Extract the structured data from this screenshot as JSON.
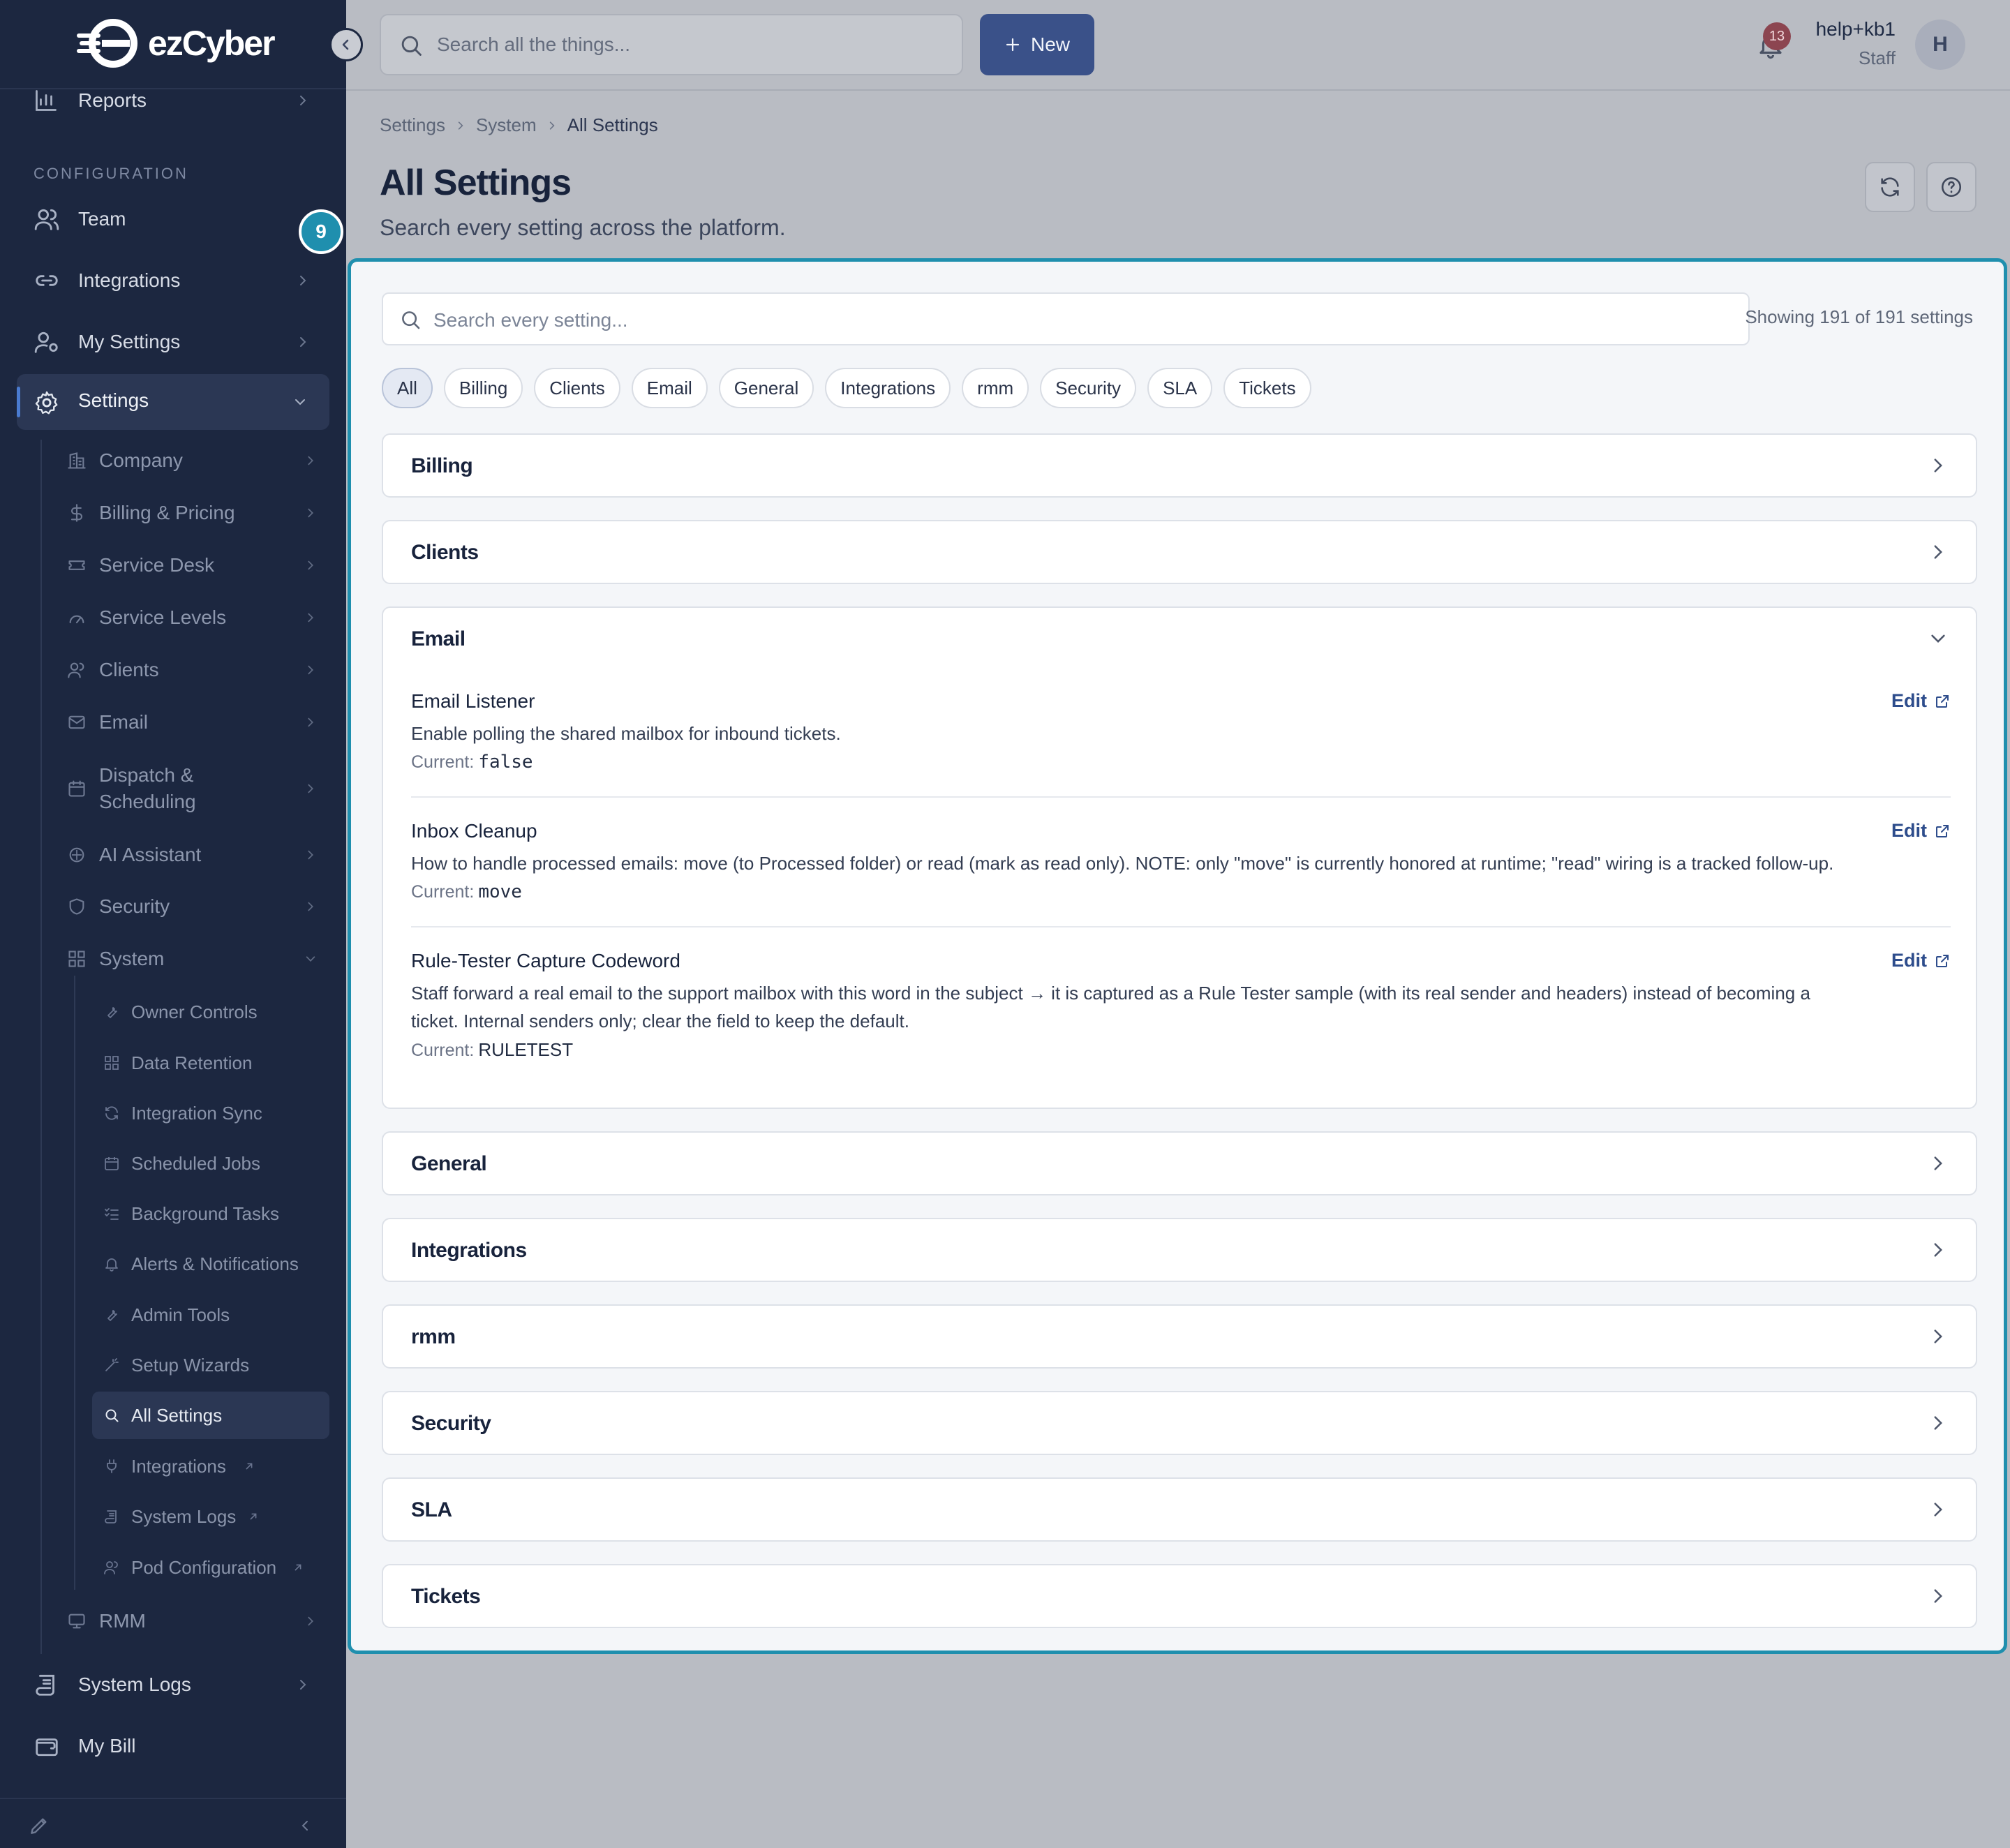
{
  "app": {
    "brand": "ezCyber",
    "accent": "#1f8fae",
    "primary_button": "#3a5189"
  },
  "sidebar": {
    "top_items": [
      {
        "label": "Reports",
        "icon": "bar-chart-icon"
      }
    ],
    "section_title": "CONFIGURATION",
    "config_items": [
      {
        "label": "Team",
        "icon": "users-icon"
      },
      {
        "label": "Integrations",
        "icon": "link-icon"
      },
      {
        "label": "My Settings",
        "icon": "user-gear-icon"
      },
      {
        "label": "Settings",
        "icon": "gear-icon"
      }
    ],
    "team_badge": "9",
    "settings_sub": [
      {
        "label": "Company",
        "icon": "building-icon"
      },
      {
        "label": "Billing & Pricing",
        "icon": "dollar-icon"
      },
      {
        "label": "Service Desk",
        "icon": "ticket-icon"
      },
      {
        "label": "Service Levels",
        "icon": "gauge-icon"
      },
      {
        "label": "Clients",
        "icon": "users-icon"
      },
      {
        "label": "Email",
        "icon": "mail-icon"
      },
      {
        "label": "Dispatch & Scheduling",
        "icon": "calendar-icon"
      },
      {
        "label": "AI Assistant",
        "icon": "sparkle-icon"
      },
      {
        "label": "Security",
        "icon": "shield-icon"
      },
      {
        "label": "System",
        "icon": "grid-icon"
      }
    ],
    "system_sub": [
      {
        "label": "Owner Controls",
        "icon": "wrench-icon"
      },
      {
        "label": "Data Retention",
        "icon": "grid-icon"
      },
      {
        "label": "Integration Sync",
        "icon": "refresh-icon"
      },
      {
        "label": "Scheduled Jobs",
        "icon": "calendar-icon"
      },
      {
        "label": "Background Tasks",
        "icon": "list-check-icon"
      },
      {
        "label": "Alerts & Notifications",
        "icon": "bell-icon"
      },
      {
        "label": "Admin Tools",
        "icon": "wrench-icon"
      },
      {
        "label": "Setup Wizards",
        "icon": "wand-icon"
      },
      {
        "label": "All Settings",
        "icon": "search-icon"
      },
      {
        "label": "Integrations",
        "icon": "plug-icon"
      },
      {
        "label": "System Logs",
        "icon": "scroll-icon"
      },
      {
        "label": "Pod Configuration",
        "icon": "users-icon"
      }
    ],
    "rmm_item": {
      "label": "RMM",
      "icon": "monitor-icon"
    },
    "bottom_items": [
      {
        "label": "System Logs",
        "icon": "scroll-icon"
      },
      {
        "label": "My Bill",
        "icon": "wallet-icon"
      }
    ]
  },
  "header": {
    "search_placeholder": "Search all the things...",
    "new_button": "New",
    "notification_count": "13",
    "user_name": "help+kb1",
    "user_role": "Staff",
    "avatar_initial": "H"
  },
  "page": {
    "breadcrumb": [
      "Settings",
      "System",
      "All Settings"
    ],
    "title": "All Settings",
    "subtitle": "Search every setting across the platform."
  },
  "settings_panel": {
    "search_placeholder": "Search every setting...",
    "showing": "Showing 191 of 191 settings",
    "filters": [
      "All",
      "Billing",
      "Clients",
      "Email",
      "General",
      "Integrations",
      "rmm",
      "Security",
      "SLA",
      "Tickets"
    ],
    "active_filter": "All",
    "groups": [
      "Billing",
      "Clients",
      "Email",
      "General",
      "Integrations",
      "rmm",
      "Security",
      "SLA",
      "Tickets"
    ],
    "expanded_group": "Email",
    "current_label": "Current:",
    "edit_label": "Edit",
    "email_settings": [
      {
        "name": "Email Listener",
        "description": "Enable polling the shared mailbox for inbound tickets.",
        "current": "false"
      },
      {
        "name": "Inbox Cleanup",
        "description": "How to handle processed emails: move (to Processed folder) or read (mark as read only). NOTE: only \"move\" is currently honored at runtime; \"read\" wiring is a tracked follow-up.",
        "current": "move"
      },
      {
        "name": "Rule-Tester Capture Codeword",
        "description": "Staff forward a real email to the support mailbox with this word in the subject → it is captured as a Rule Tester sample (with its real sender and headers) instead of becoming a ticket. Internal senders only; clear the field to keep the default.",
        "current": "RULETEST"
      }
    ]
  }
}
